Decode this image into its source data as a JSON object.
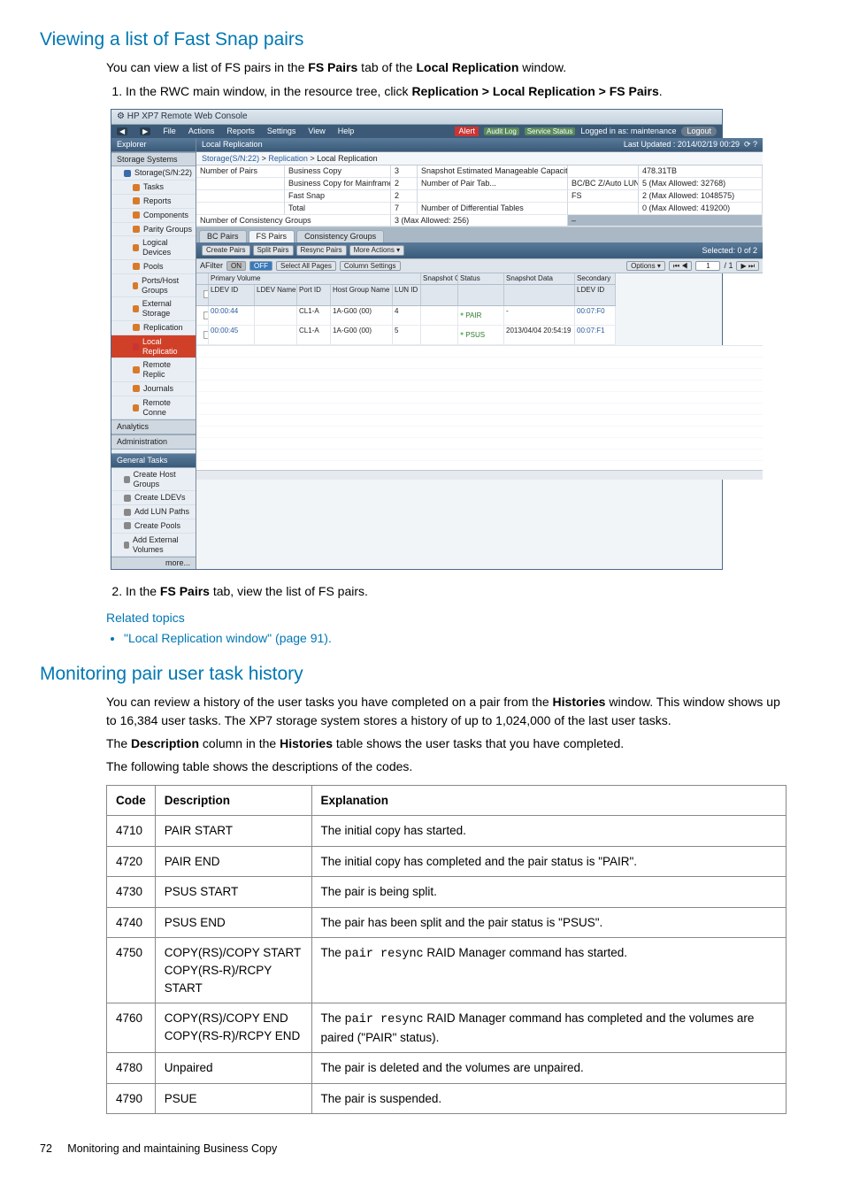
{
  "section1": {
    "title": "Viewing a list of Fast Snap pairs",
    "intro_pre": "You can view a list of FS pairs in the ",
    "intro_bold1": "FS Pairs",
    "intro_mid": " tab of the ",
    "intro_bold2": "Local Replication",
    "intro_post": " window.",
    "step1_pre": "In the RWC main window, in the resource tree, click ",
    "step1_bold": "Replication > Local Replication > FS Pairs",
    "step1_post": ".",
    "step2_pre": "In the ",
    "step2_bold": "FS Pairs",
    "step2_post": " tab, view the list of FS pairs."
  },
  "screenshot": {
    "title": "HP XP7 Remote Web Console",
    "menus": [
      "File",
      "Actions",
      "Reports",
      "Settings",
      "View",
      "Help"
    ],
    "alert": "Alert",
    "audit": "Audit Log",
    "status_btn": "Service Status",
    "login_status": "Logged in as: maintenance",
    "logout": "Logout",
    "explorer": "Explorer",
    "storage_sys": "Storage Systems",
    "nav": {
      "root": "Storage(S/N:22)",
      "tasks": "Tasks",
      "reports": "Reports",
      "components": "Components",
      "parity": "Parity Groups",
      "logical": "Logical Devices",
      "pools": "Pools",
      "ports": "Ports/Host Groups",
      "ext": "External Storage",
      "repl": "Replication",
      "local": "Local Replicatio",
      "remote": "Remote Replic",
      "journals": "Journals",
      "remconn": "Remote Conne"
    },
    "analytics": "Analytics",
    "admin": "Administration",
    "general": "General Tasks",
    "tasks": [
      "Create Host Groups",
      "Create LDEVs",
      "Add LUN Paths",
      "Create Pools",
      "Add External Volumes"
    ],
    "more": "more...",
    "main_title": "Local Replication",
    "last_updated": "Last Updated : 2014/02/19 00:29",
    "crumb1": "Storage(S/N:22)",
    "crumb2": "Replication",
    "crumb3": "Local Replication",
    "stats": {
      "r1c1": "Number of Pairs",
      "r1c2": "Business Copy",
      "r1c3": "3",
      "r1c4": "Snapshot Estimated Manageable Capacity",
      "r1c6": "478.31TB",
      "r2c2": "Business Copy for Mainframe",
      "r2c3": "2",
      "r2c4": "Number of Pair Tab...",
      "r2c5": "BC/BC Z/Auto LUN",
      "r2c6": "5 (Max Allowed: 32768)",
      "r3c2": "Fast Snap",
      "r3c3": "2",
      "r3c5": "FS",
      "r3c6": "2 (Max Allowed: 1048575)",
      "r4c2": "Total",
      "r4c3": "7",
      "r4c4": "Number of Differential Tables",
      "r4c6": "0 (Max Allowed: 419200)",
      "r5c1": "Number of Consistency Groups",
      "r5c3": "3 (Max Allowed: 256)"
    },
    "tabs": [
      "BC Pairs",
      "FS Pairs",
      "Consistency Groups"
    ],
    "tb": {
      "create": "Create Pairs",
      "split": "Split Pairs",
      "resync": "Resync Pairs",
      "more": "More Actions",
      "selected": "Selected: 0 of 2"
    },
    "filter": {
      "label": "AFilter",
      "on": "ON",
      "off": "OFF",
      "select": "Select All Pages",
      "col": "Column Settings",
      "options": "Options ▾",
      "page": "1",
      "pagetot": "/ 1"
    },
    "grid": {
      "h_top_primary": "Primary Volume",
      "h_top_snap": "Snapshot Group",
      "h_top_sec": "Secondary",
      "h_ldev": "LDEV ID",
      "h_ldevname": "LDEV Name",
      "h_port": "Port ID",
      "h_hostgrp": "Host Group Name",
      "h_lun": "LUN ID",
      "h_status": "Status",
      "h_snapdata": "Snapshot Data",
      "h_secldev": "LDEV ID",
      "rows": [
        {
          "ldev": "00:00:44",
          "port": "CL1-A",
          "host": "1A-G00 (00)",
          "lun": "4",
          "status": "PAIR",
          "snap": "-",
          "sec": "00:07:F0"
        },
        {
          "ldev": "00:00:45",
          "port": "CL1-A",
          "host": "1A-G00 (00)",
          "lun": "5",
          "status": "PSUS",
          "snap": "2013/04/04 20:54:19",
          "sec": "00:07:F1"
        }
      ]
    }
  },
  "related": {
    "heading": "Related topics",
    "item": "\"Local Replication window\" (page 91)."
  },
  "section2": {
    "title": "Monitoring pair user task history",
    "p1_pre": "You can review a history of the user tasks you have completed on a pair from the ",
    "p1_bold": "Histories",
    "p1_post": " window. This window shows up to 16,384 user tasks. The XP7 storage system stores a history of up to 1,024,000 of the last user tasks.",
    "p2_pre": "The ",
    "p2_b1": "Description",
    "p2_mid": " column in the ",
    "p2_b2": "Histories",
    "p2_post": " table shows the user tasks that you have completed.",
    "p3": "The following table shows the descriptions of the codes."
  },
  "table": {
    "h1": "Code",
    "h2": "Description",
    "h3": "Explanation",
    "rows": [
      {
        "code": "4710",
        "desc": "PAIR START",
        "exp_text": "The initial copy has started."
      },
      {
        "code": "4720",
        "desc": "PAIR END",
        "exp_text": "The initial copy has completed and the pair status is \"PAIR\"."
      },
      {
        "code": "4730",
        "desc": "PSUS START",
        "exp_text": "The pair is being split."
      },
      {
        "code": "4740",
        "desc": "PSUS END",
        "exp_text": "The pair has been split and the pair status is \"PSUS\"."
      },
      {
        "code": "4750",
        "desc": "COPY(RS)/COPY START\nCOPY(RS-R)/RCPY START",
        "exp_pre": "The ",
        "exp_code": "pair resync",
        "exp_post": " RAID Manager command has started."
      },
      {
        "code": "4760",
        "desc": "COPY(RS)/COPY END\nCOPY(RS-R)/RCPY END",
        "exp_pre": "The ",
        "exp_code": "pair resync",
        "exp_post": " RAID Manager command has completed and the volumes are paired (\"PAIR\" status)."
      },
      {
        "code": "4780",
        "desc": "Unpaired",
        "exp_text": "The pair is deleted and the volumes are unpaired."
      },
      {
        "code": "4790",
        "desc": "PSUE",
        "exp_text": "The pair is suspended."
      }
    ]
  },
  "footer": {
    "pagenum": "72",
    "chapter": "Monitoring and maintaining Business Copy"
  }
}
